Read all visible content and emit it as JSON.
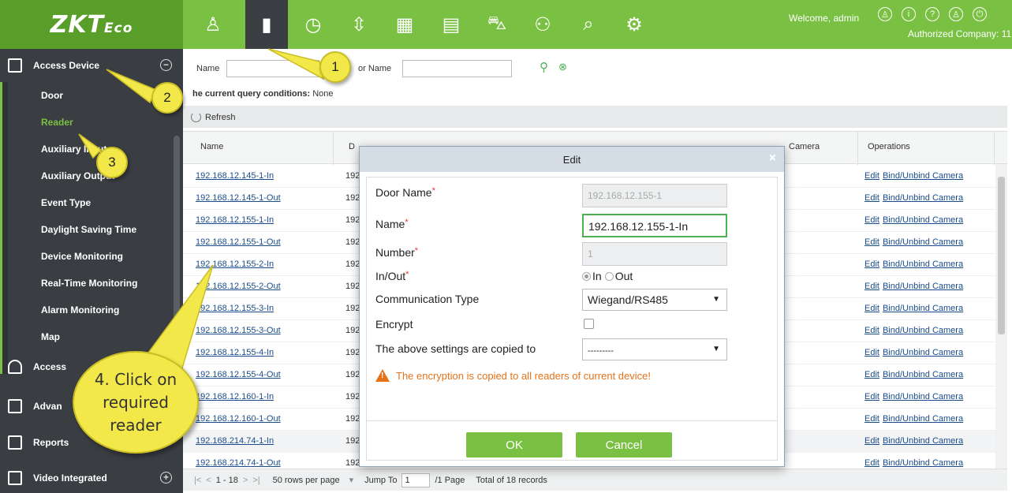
{
  "app": {
    "logo_main": "ZKT",
    "logo_suffix": "Eco",
    "welcome": "Welcome, admin",
    "authorized": "Authorized Company: 11",
    "accent_color": "#7ac143"
  },
  "modules": [
    {
      "icon": "person-icon",
      "glyph": "♙"
    },
    {
      "icon": "door-icon",
      "glyph": "▮"
    },
    {
      "icon": "clock-icon",
      "glyph": "◷"
    },
    {
      "icon": "elevator-icon",
      "glyph": "⇳"
    },
    {
      "icon": "building-icon",
      "glyph": "▦"
    },
    {
      "icon": "visitor-icon",
      "glyph": "▤"
    },
    {
      "icon": "car-icon",
      "glyph": "⛍"
    },
    {
      "icon": "patrol-icon",
      "glyph": "⚇"
    },
    {
      "icon": "camera-icon",
      "glyph": "⌕"
    },
    {
      "icon": "gear-icon",
      "glyph": "⚙"
    }
  ],
  "sidebar": {
    "group_access_device": "Access Device",
    "items": [
      "Door",
      "Reader",
      "Auxiliary Input",
      "Auxiliary Output",
      "Event Type",
      "Daylight Saving Time",
      "Device Monitoring",
      "Real-Time Monitoring",
      "Alarm Monitoring",
      "Map"
    ],
    "group_access": "Access",
    "group_advanced": "Advan",
    "group_reports": "Reports",
    "group_video": "Video Integrated"
  },
  "query": {
    "name_label": "Name",
    "door_name_label": "or Name",
    "conditions_label": "he current query conditions:",
    "conditions_value": "None"
  },
  "toolbar": {
    "refresh": "Refresh"
  },
  "grid": {
    "col_name": "Name",
    "col_door": "D",
    "col_camera": "Camera",
    "col_operations": "Operations",
    "op_edit": "Edit",
    "op_bind": "Bind/Unbind Camera",
    "rows": [
      {
        "name": "192.168.12.145-1-In",
        "door": "192"
      },
      {
        "name": "192.168.12.145-1-Out",
        "door": "192"
      },
      {
        "name": "192.168.12.155-1-In",
        "door": "192"
      },
      {
        "name": "192.168.12.155-1-Out",
        "door": "192"
      },
      {
        "name": "192.168.12.155-2-In",
        "door": "192"
      },
      {
        "name": "192.168.12.155-2-Out",
        "door": "192"
      },
      {
        "name": "192.168.12.155-3-In",
        "door": "192"
      },
      {
        "name": "192.168.12.155-3-Out",
        "door": "192"
      },
      {
        "name": "192.168.12.155-4-In",
        "door": "192"
      },
      {
        "name": "192.168.12.155-4-Out",
        "door": "192"
      },
      {
        "name": "192.168.12.160-1-In",
        "door": "192"
      },
      {
        "name": "192.168.12.160-1-Out",
        "door": "192"
      },
      {
        "name": "192.168.214.74-1-In",
        "door": "192"
      },
      {
        "name": "192.168.214.74-1-Out",
        "door": "192"
      }
    ]
  },
  "pager": {
    "nav_first": "|<",
    "nav_prev": "<",
    "range": "1 - 18",
    "nav_next": ">",
    "nav_last": ">|",
    "rows_per_page": "50 rows per page",
    "jump_label": "Jump To",
    "jump_value": "1",
    "page_label": "/1 Page",
    "total": "Total of 18 records"
  },
  "modal": {
    "title": "Edit",
    "door_name_label": "Door Name",
    "door_name_value": "192.168.12.155-1",
    "name_label": "Name",
    "name_value": "192.168.12.155-1-In",
    "number_label": "Number",
    "number_value": "1",
    "inout_label": "In/Out",
    "in_label": "In",
    "out_label": "Out",
    "inout_selected": "In",
    "comm_label": "Communication Type",
    "comm_value": "Wiegand/RS485",
    "encrypt_label": "Encrypt",
    "copy_label": "The above settings are copied to",
    "copy_value": "---------",
    "warning": "The encryption is copied to all readers of current device!",
    "ok": "OK",
    "cancel": "Cancel",
    "required_mark": "*"
  },
  "callouts": {
    "c1": "1",
    "c2": "2",
    "c3": "3",
    "c4_line1": "4. Click on",
    "c4_line2": "required",
    "c4_line3": "reader"
  }
}
